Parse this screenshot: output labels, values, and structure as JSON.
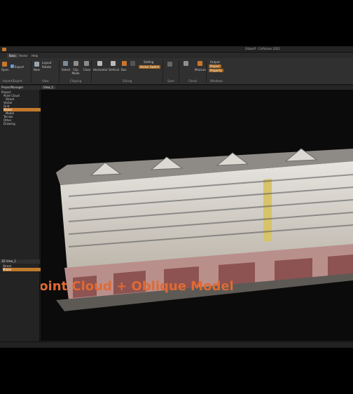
{
  "window": {
    "title": "OsbaxP - CoPinions 2021"
  },
  "menu": {
    "tabs": [
      "Basic",
      "Vector",
      "Help"
    ],
    "active_index": 0
  },
  "ribbon": {
    "import_export": {
      "items": [
        "Open",
        "Export"
      ],
      "group": "Import/Export"
    },
    "view": {
      "items": [
        "New",
        "Layout",
        "Rotate"
      ],
      "group": "View"
    },
    "clipping": {
      "items": [
        "Select",
        "Clip Mode",
        "Clear"
      ],
      "group": "Clipping"
    },
    "slicing": {
      "items": [
        "Horizontal",
        "Vertical",
        "Box",
        "Setting",
        "Vector Switch"
      ],
      "group": "Slicing"
    },
    "save": {
      "items": [
        "Save"
      ],
      "group": "Save"
    },
    "check": {
      "items": [
        "Measure"
      ],
      "group": "Check"
    },
    "windows": {
      "items": [
        "Output",
        "Project",
        "Property"
      ],
      "group": "Windows"
    }
  },
  "project_manager": {
    "header": "ProjectManager",
    "items": [
      {
        "label": "Project",
        "indent": 0
      },
      {
        "label": "Point Cloud",
        "indent": 1
      },
      {
        "label": "Street",
        "indent": 2
      },
      {
        "label": "Vector",
        "indent": 1
      },
      {
        "label": "Grid",
        "indent": 1
      },
      {
        "label": "Model",
        "indent": 1,
        "selected": true
      },
      {
        "label": "Model",
        "indent": 2
      },
      {
        "label": "Terrain",
        "indent": 1
      },
      {
        "label": "Other",
        "indent": 1
      },
      {
        "label": "Drawing",
        "indent": 1
      }
    ]
  },
  "view_panel": {
    "header": "3D View_1",
    "items": [
      {
        "label": "Street",
        "selected": false
      },
      {
        "label": "Model",
        "selected": true
      }
    ]
  },
  "viewport": {
    "tab": "View_1",
    "caption": "Point Cloud + Oblique Model"
  },
  "colors": {
    "accent": "#c27a2c",
    "caption": "#e06a33"
  }
}
